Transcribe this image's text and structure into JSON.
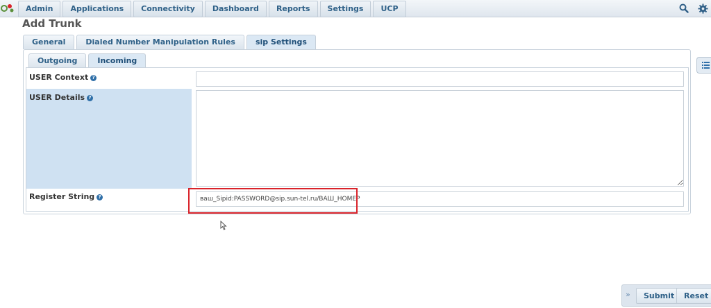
{
  "nav": {
    "items": [
      "Admin",
      "Applications",
      "Connectivity",
      "Dashboard",
      "Reports",
      "Settings",
      "UCP"
    ],
    "search_icon": "search-icon",
    "settings_icon": "gear-icon"
  },
  "page_title": "Add Trunk",
  "outer_tabs": [
    "General",
    "Dialed Number Manipulation Rules",
    "sip Settings"
  ],
  "outer_active": "sip Settings",
  "inner_tabs": [
    "Outgoing",
    "Incoming"
  ],
  "inner_active": "Incoming",
  "form": {
    "user_context_label": "USER Context",
    "user_context_value": "",
    "user_details_label": "USER Details",
    "user_details_value": "",
    "register_string_label": "Register String",
    "register_string_value": "ваш_Sipid:PASSWORD@sip.sun-tel.ru/ВАШ_НОМЕР"
  },
  "actions": {
    "submit_label": "Submit",
    "reset_label": "Reset"
  },
  "colors": {
    "accent": "#2f6188",
    "highlight": "#d9232a",
    "row_highlight": "#cfe1f2"
  }
}
